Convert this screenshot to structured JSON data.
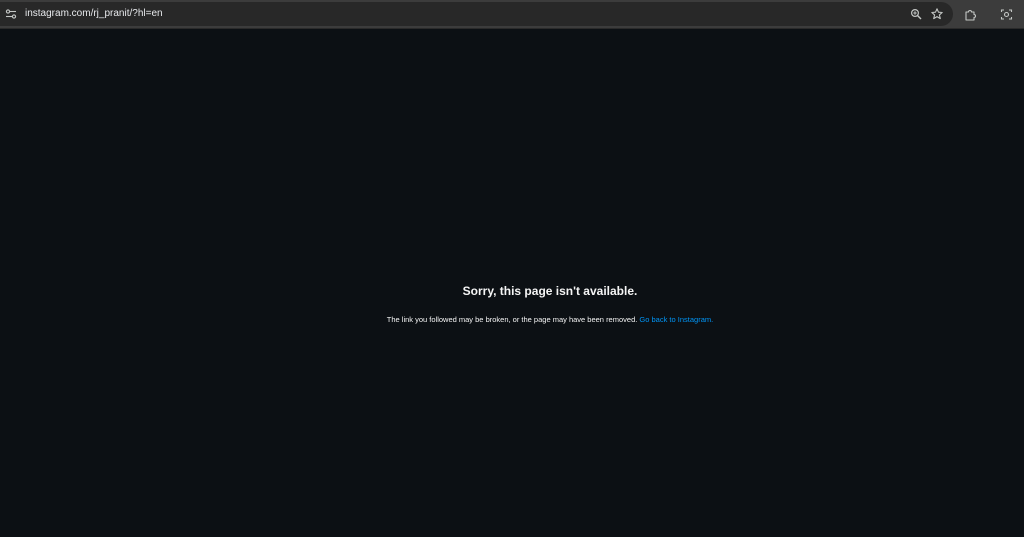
{
  "browser": {
    "url": "instagram.com/rj_pranit/?hl=en",
    "icons": {
      "site_info": "tune-icon",
      "zoom": "zoom-icon",
      "bookmark": "star-icon",
      "extensions": "puzzle-piece-icon",
      "screenshot": "capture-icon"
    },
    "colors": {
      "toolbar": "#3c3c3c",
      "omnibox": "#282828",
      "text": "#e8eaed"
    }
  },
  "page": {
    "title": "Sorry, this page isn't available.",
    "message": "The link you followed may be broken, or the page may have been removed.",
    "link_label": "Go back to Instagram.",
    "colors": {
      "background": "#0c1014",
      "text": "#f5f5f5",
      "link": "#0095f6"
    }
  }
}
